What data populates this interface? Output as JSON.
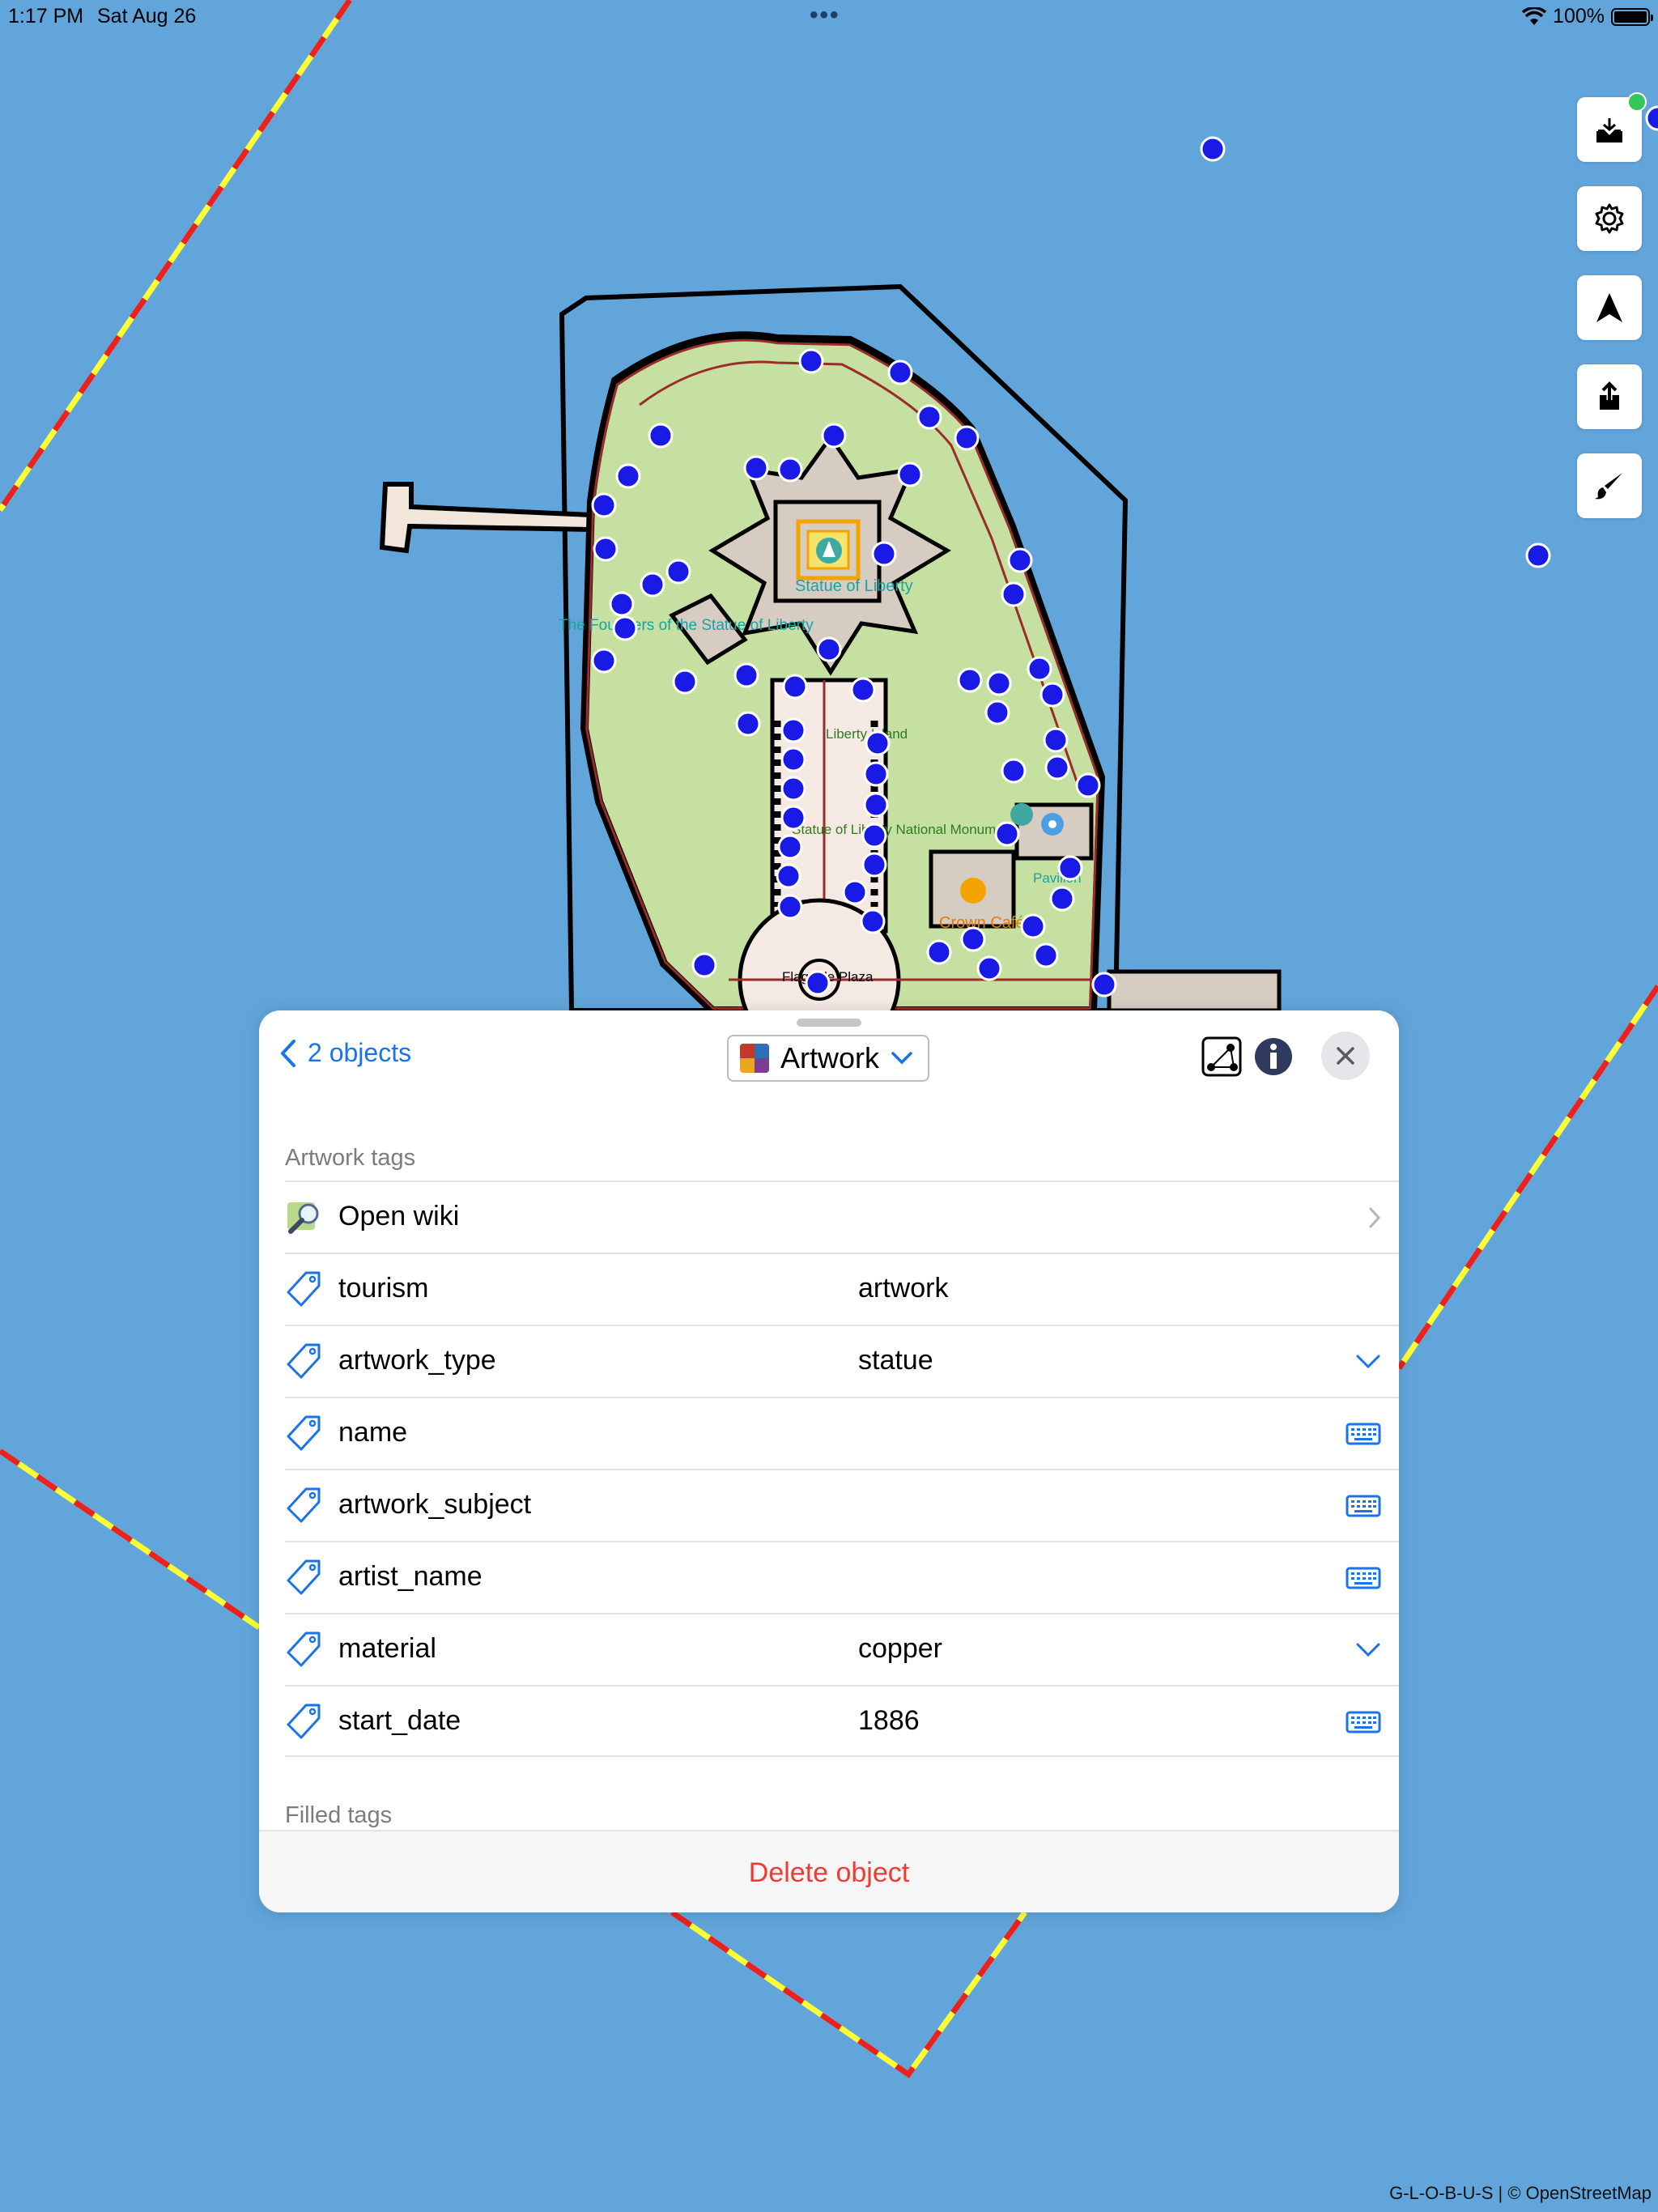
{
  "status_bar": {
    "time": "1:17 PM",
    "date": "Sat Aug 26",
    "battery": "100%",
    "menu": "•••"
  },
  "map_labels": {
    "statue": "Statue of Liberty",
    "founders": "The Founders of the Statue of Liberty",
    "island": "Liberty Island",
    "monument": "Statue of Liberty National Monument",
    "cafe": "Crown Café",
    "pavilion": "Pavilion",
    "plaza": "Flagpole Plaza"
  },
  "toolbar": {
    "upload_icon": "upload-tray-icon",
    "settings_icon": "gear-icon",
    "location_icon": "navigation-arrow-icon",
    "share_icon": "share-icon",
    "brush_icon": "brush-icon",
    "upload_badge_color": "#33c759"
  },
  "attribution": "G-L-O-B-U-S | © OpenStreetMap",
  "sheet": {
    "back_label": "2 objects",
    "preset_label": "Artwork",
    "section_title": "Artwork tags",
    "filled_title": "Filled tags",
    "delete_label": "Delete object",
    "rows": [
      {
        "key": "Open wiki",
        "value": "",
        "icon": "wiki-icon",
        "accessory": "chevron-right"
      },
      {
        "key": "tourism",
        "value": "artwork",
        "icon": "tag-icon",
        "accessory": ""
      },
      {
        "key": "artwork_type",
        "value": "statue",
        "icon": "tag-icon",
        "accessory": "dropdown"
      },
      {
        "key": "name",
        "value": "",
        "icon": "tag-icon",
        "accessory": "keyboard"
      },
      {
        "key": "artwork_subject",
        "value": "",
        "icon": "tag-icon",
        "accessory": "keyboard"
      },
      {
        "key": "artist_name",
        "value": "",
        "icon": "tag-icon",
        "accessory": "keyboard"
      },
      {
        "key": "material",
        "value": "copper",
        "icon": "tag-icon",
        "accessory": "dropdown"
      },
      {
        "key": "start_date",
        "value": "1886",
        "icon": "tag-icon",
        "accessory": "keyboard"
      }
    ]
  },
  "colors": {
    "accent": "#1a73e8",
    "delete": "#ef3b36",
    "water": "#62a5db",
    "park": "#c5e0a0",
    "node": "#1a1ae6"
  }
}
